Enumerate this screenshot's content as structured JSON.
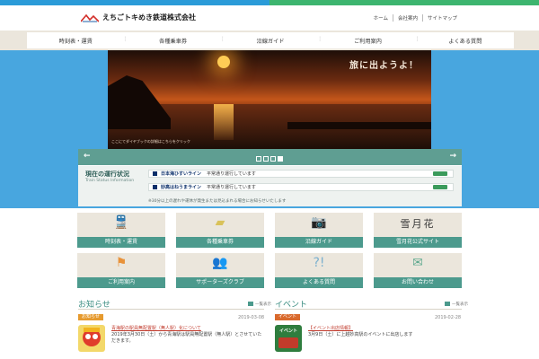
{
  "header": {
    "company": "えちごトキめき鉄道株式会社",
    "utility_links": [
      "ホーム",
      "会社案内",
      "サイトマップ"
    ]
  },
  "nav": [
    "時刻表・運賃",
    "各種乗車券",
    "沿線ガイド",
    "ご利用案内",
    "よくある質問"
  ],
  "hero": {
    "slogan": "旅に出ようよ！",
    "caption": "ここにてダイヤブックの詳細はこちらをクリック",
    "slides": 4,
    "active_slide": 4
  },
  "status": {
    "title": "現在の運行状況",
    "subtitle": "Train Status Information",
    "lines": [
      {
        "name": "日本海ひすいライン",
        "status": "平常通り運行しています"
      },
      {
        "name": "妙高はねうまライン",
        "status": "平常通り運行しています"
      }
    ],
    "note": "※30分以上の遅れや運休が発生または見込まれる場合にお知らせいたします"
  },
  "tiles": [
    {
      "label": "時刻表・運賃",
      "icon": "train-icon"
    },
    {
      "label": "各種乗車券",
      "icon": "ticket-icon"
    },
    {
      "label": "沿線ガイド",
      "icon": "camera-icon"
    },
    {
      "label": "雪月花公式サイト",
      "icon": "setsugekka-logo",
      "logo_text": "雪月花"
    },
    {
      "label": "ご利用案内",
      "icon": "flag-icon"
    },
    {
      "label": "サポーターズクラブ",
      "icon": "people-icon"
    },
    {
      "label": "よくある質問",
      "icon": "question-icon"
    },
    {
      "label": "お問い合わせ",
      "icon": "mail-icon"
    }
  ],
  "news": {
    "title": "お知らせ",
    "more": "一覧表示",
    "item": {
      "badge": "お知らせ",
      "date": "2019-03-08",
      "link": "青海駅の駅員無配置駅（無人駅）化について",
      "text": "2019年3月30日（土）から青海駅は駅員無配置駅（無人駅）とさせていただきます。"
    }
  },
  "events": {
    "title": "イベント",
    "more": "一覧表示",
    "item": {
      "badge": "イベント",
      "date": "2019-02-28",
      "link": "【イベント出店情報】",
      "text": "3月9日（土）に上越妙高駅のイベントに出店します",
      "thumb_text": "イベント"
    }
  },
  "colors": {
    "teal": "#4c9a8d",
    "beige": "#ebe6dc",
    "sky": "#48a6df",
    "news_badge": "#e69a2e",
    "event_badge": "#d9692c"
  }
}
